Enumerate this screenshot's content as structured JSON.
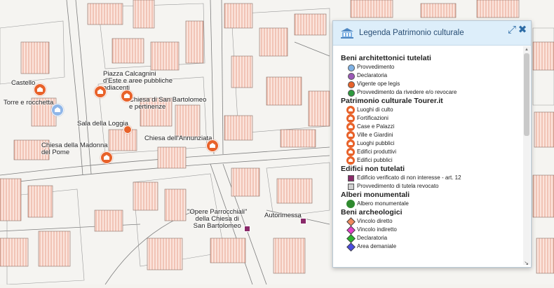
{
  "map": {
    "labels": [
      {
        "id": "castello",
        "text": "Castello"
      },
      {
        "id": "torre",
        "text": "Torre e rocchetta"
      },
      {
        "id": "piazza",
        "text": "Piazza Calcagnini\nd'Este e aree pubbliche\nadiacenti"
      },
      {
        "id": "chiesa-bartolomeo",
        "text": "Chiesa di San Bartolomeo\ne pertinenze"
      },
      {
        "id": "loggia",
        "text": "Sala della Loggia"
      },
      {
        "id": "madonna",
        "text": "Chiesa della Madonna\ndel Pome"
      },
      {
        "id": "annunziata",
        "text": "Chiesa dell'Annunziata"
      },
      {
        "id": "opere",
        "text": "\"Opere Parrocchiali\"\ndella Chiesa di\nSan Bartolomeo"
      },
      {
        "id": "autorimessa",
        "text": "Autorimessa"
      }
    ]
  },
  "legend": {
    "title": "Legenda Patrimonio culturale",
    "collapse_icon": "collapse-arrows-icon",
    "close_icon": "close-x-icon",
    "sections": [
      {
        "title": "Beni architettonici tutelati",
        "items": [
          {
            "label": "Provvedimento",
            "symbol": "dot",
            "color": "#7fb2e5"
          },
          {
            "label": "Declaratoria",
            "symbol": "dot",
            "color": "#9b59b6"
          },
          {
            "label": "Vigente ope legis",
            "symbol": "dot",
            "color": "#e8622a"
          },
          {
            "label": "Provvedimento da rivedere e/o revocare",
            "symbol": "dot",
            "color": "#2e9a3e"
          }
        ]
      },
      {
        "title": "Patrimonio culturale Tourer.it",
        "items": [
          {
            "label": "Luoghi di culto",
            "symbol": "poi",
            "color": "#e8622a"
          },
          {
            "label": "Fortificazioni",
            "symbol": "poi",
            "color": "#e8622a"
          },
          {
            "label": "Case e Palazzi",
            "symbol": "poi",
            "color": "#e8622a"
          },
          {
            "label": "Ville e Giardini",
            "symbol": "poi",
            "color": "#e8622a"
          },
          {
            "label": "Luoghi pubblici",
            "symbol": "poi",
            "color": "#e8622a"
          },
          {
            "label": "Edifici produttivi",
            "symbol": "poi",
            "color": "#e8622a"
          },
          {
            "label": "Edifici pubblici",
            "symbol": "poi",
            "color": "#e8622a"
          }
        ]
      },
      {
        "title": "Edifici non tutelati",
        "items": [
          {
            "label": "Edificio verificato di non interesse - art. 12",
            "symbol": "square",
            "color": "#8a2a6a"
          },
          {
            "label": "Provvedimento di tutela revocato",
            "symbol": "square",
            "color": "#cfcfcf"
          }
        ]
      },
      {
        "title": "Alberi monumentali",
        "items": [
          {
            "label": "Albero monumentale",
            "symbol": "tree",
            "color": "#2f8a2f"
          }
        ]
      },
      {
        "title": "Beni archeologici",
        "items": [
          {
            "label": "Vincolo diretto",
            "symbol": "diamond",
            "color": "#f08a5d"
          },
          {
            "label": "Vincolo indiretto",
            "symbol": "diamond",
            "color": "#e33fc8"
          },
          {
            "label": "Declaratoria",
            "symbol": "diamond",
            "color": "#2ab52a"
          },
          {
            "label": "Area demaniale",
            "symbol": "diamond",
            "color": "#4b4be0"
          }
        ]
      }
    ]
  }
}
